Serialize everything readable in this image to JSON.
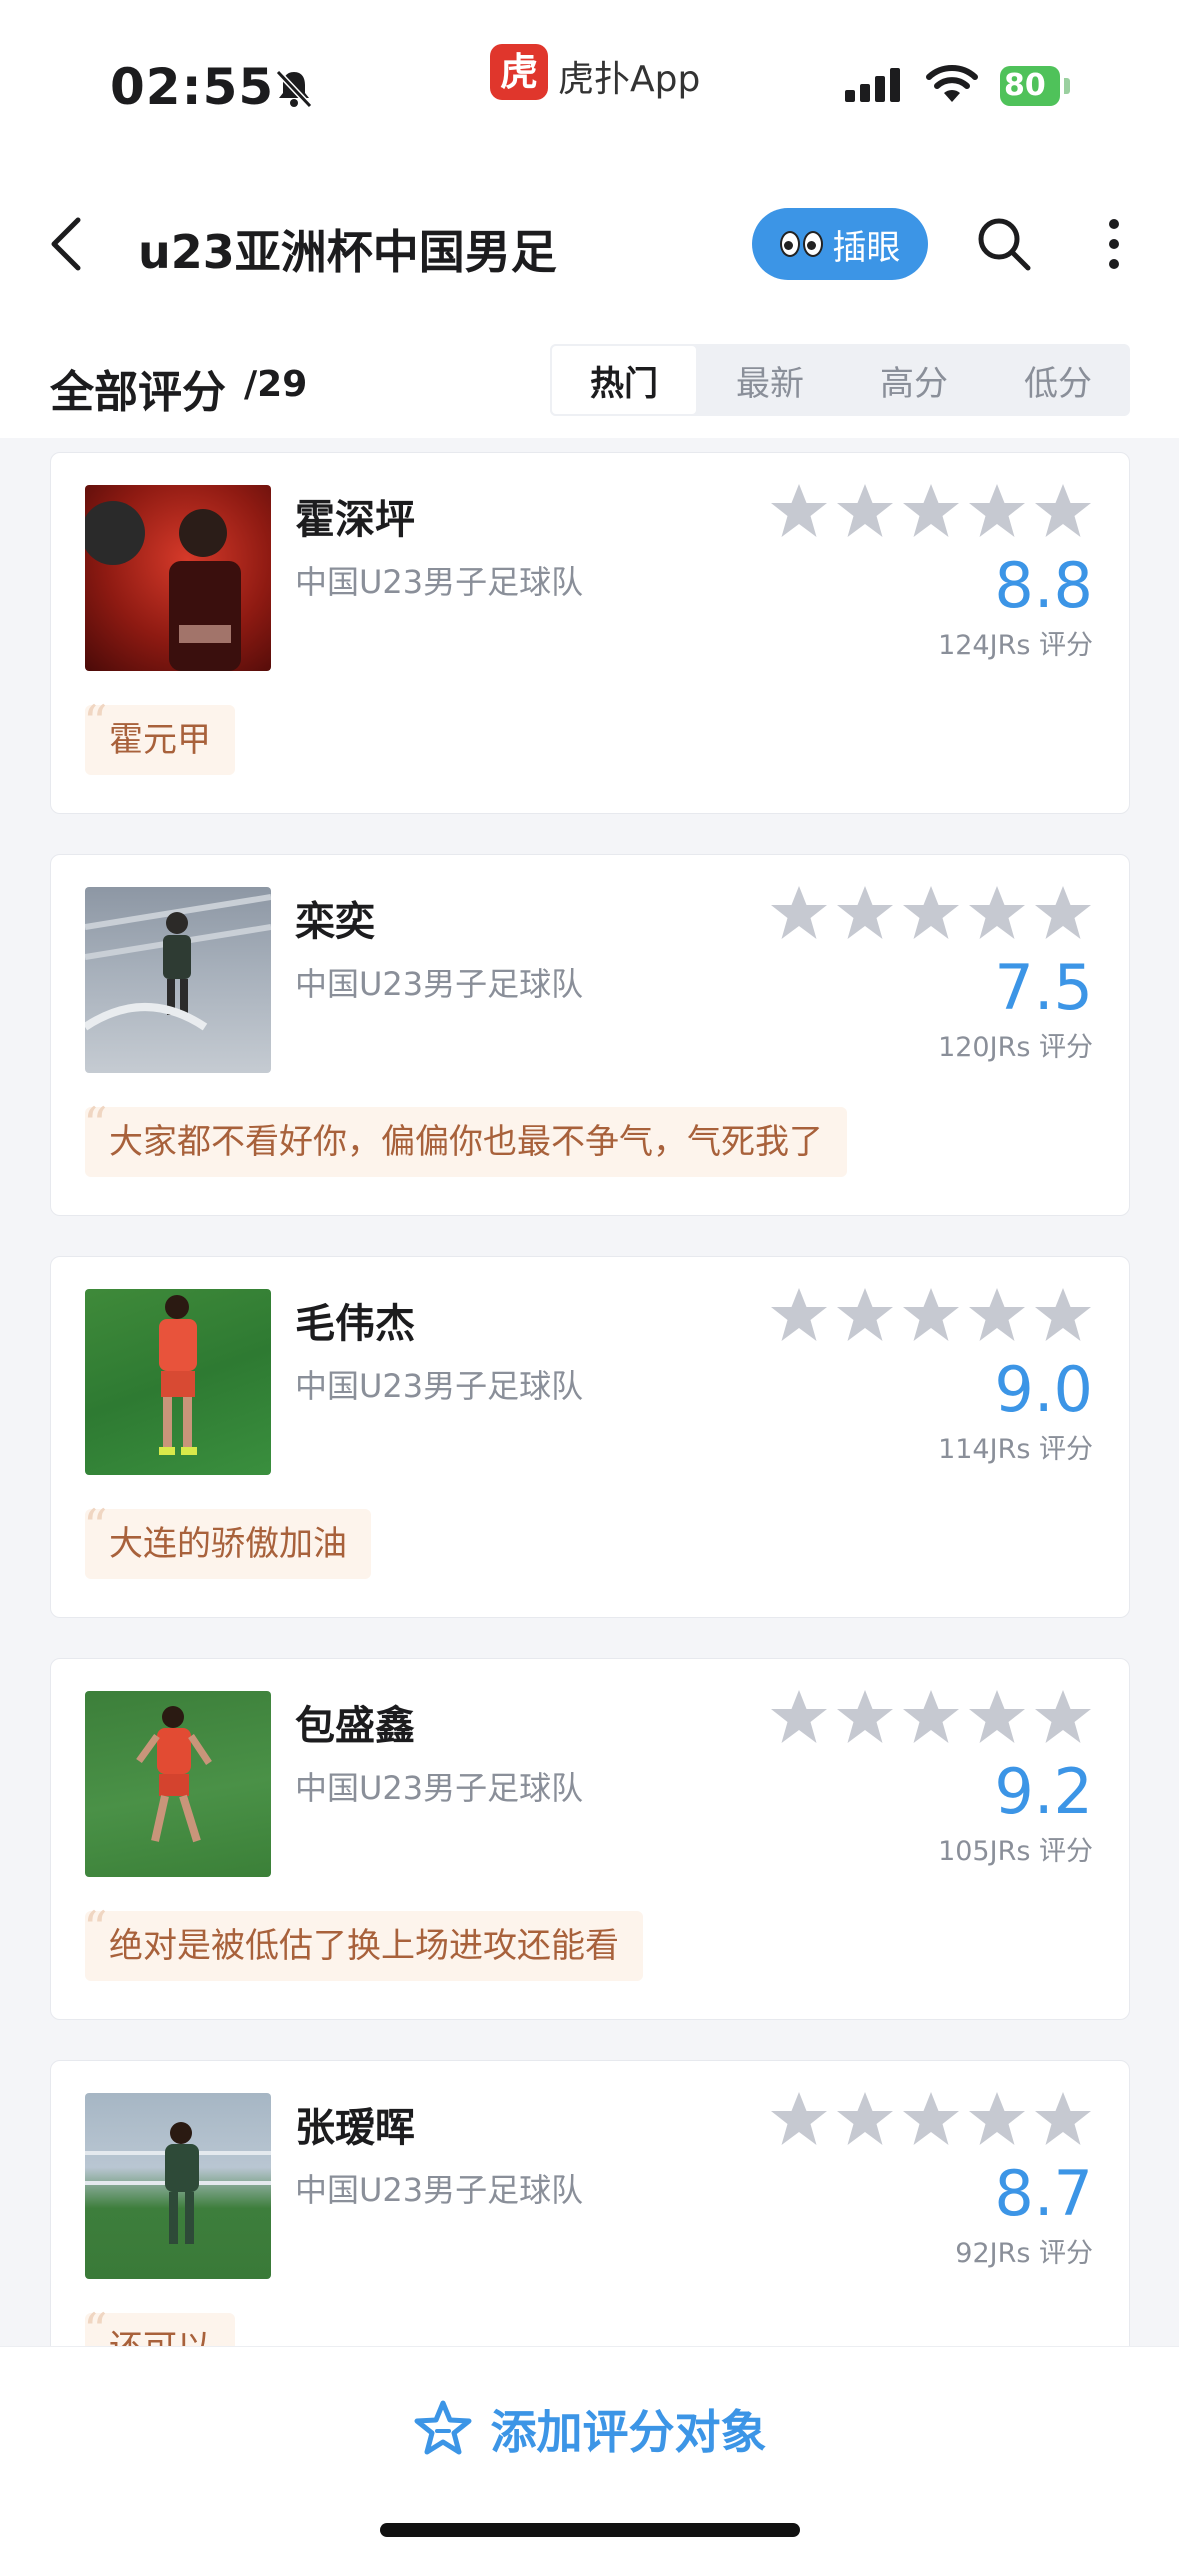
{
  "status_bar": {
    "time": "02:55",
    "app_badge": "虎",
    "app_name": "虎扑App",
    "battery": "80"
  },
  "nav": {
    "title": "u23亚洲杯中国男足",
    "chabian_label": "插眼"
  },
  "header": {
    "title": "全部评分",
    "count": "/29",
    "tabs": [
      {
        "label": "热门",
        "active": true
      },
      {
        "label": "最新",
        "active": false
      },
      {
        "label": "高分",
        "active": false
      },
      {
        "label": "低分",
        "active": false
      }
    ]
  },
  "players": [
    {
      "name": "霍深坪",
      "team": "中国U23男子足球队",
      "score": "8.8",
      "votes": "124JRs 评分",
      "comment": "霍元甲"
    },
    {
      "name": "栾奕",
      "team": "中国U23男子足球队",
      "score": "7.5",
      "votes": "120JRs 评分",
      "comment": "大家都不看好你，偏偏你也最不争气，气死我了"
    },
    {
      "name": "毛伟杰",
      "team": "中国U23男子足球队",
      "score": "9.0",
      "votes": "114JRs 评分",
      "comment": "大连的骄傲加油"
    },
    {
      "name": "包盛鑫",
      "team": "中国U23男子足球队",
      "score": "9.2",
      "votes": "105JRs 评分",
      "comment": "绝对是被低估了换上场进攻还能看"
    },
    {
      "name": "张瑷晖",
      "team": "中国U23男子足球队",
      "score": "8.7",
      "votes": "92JRs 评分",
      "comment": "还可以"
    }
  ],
  "bottom": {
    "add_label": "添加评分对象"
  },
  "colors": {
    "accent": "#3c95e6",
    "comment_bg": "#fdf4ec",
    "comment_text": "#a8613b",
    "star_gray": "#c6c9d1"
  }
}
